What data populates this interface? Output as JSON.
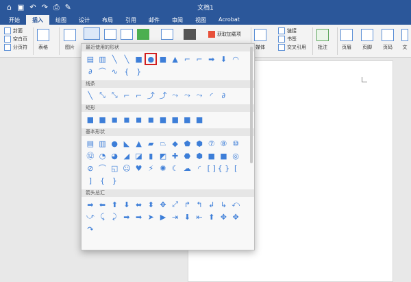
{
  "app": {
    "doc_title": "文档1",
    "qat": [
      "⌂",
      "▣",
      "↶",
      "↷",
      "⎙",
      "✎"
    ]
  },
  "tabs": [
    "开始",
    "插入",
    "绘图",
    "设计",
    "布局",
    "引用",
    "邮件",
    "审阅",
    "视图",
    "Acrobat"
  ],
  "active_tab": "插入",
  "ribbon": {
    "pages": [
      "封面",
      "空白页",
      "分页符"
    ],
    "table": "表格",
    "picture": "图片",
    "addins": "获取加载项",
    "media": "媒体",
    "links": [
      "链接",
      "书签",
      "交叉引用"
    ],
    "comment": "批注",
    "header": "页眉",
    "footer": "页脚",
    "page_number": "页码",
    "text_partial": "文"
  },
  "shapes": {
    "categories": [
      {
        "name": "最近使用的形状",
        "icons": [
          "▤",
          "▥",
          "╲",
          "╲",
          "■",
          "●",
          "■",
          "▲",
          "⌐",
          "⌐",
          "➡",
          "⬇",
          "◠",
          "∂",
          "⌒",
          "∿",
          "{",
          "}"
        ]
      },
      {
        "name": "线条",
        "icons": [
          "╲",
          "⤡",
          "⤡",
          "⌐",
          "⌐",
          "⤴",
          "⤴",
          "⤳",
          "⤳",
          "⤳",
          "◜",
          "∂"
        ]
      },
      {
        "name": "矩形",
        "icons": [
          "■",
          "■",
          "◼",
          "◼",
          "◼",
          "◼",
          "■",
          "■",
          "■",
          "■"
        ]
      },
      {
        "name": "基本形状",
        "icons": [
          "▤",
          "▥",
          "●",
          "◣",
          "▲",
          "▰",
          "⏢",
          "◆",
          "⬟",
          "⬢",
          "⑦",
          "⑧",
          "⑩",
          "⑫",
          "◔",
          "◕",
          "◢",
          "◪",
          "▮",
          "◩",
          "✚",
          "⬣",
          "⬢",
          "■",
          "■",
          "◎",
          "⊘",
          "⌒",
          "◱",
          "☺",
          "♥",
          "⚡",
          "✺",
          "☾",
          "☁",
          "◜",
          "[ ]",
          "{ }",
          "[",
          "]",
          "{",
          "}"
        ],
        "selected_index": null
      },
      {
        "name": "箭头总汇",
        "icons": [
          "➡",
          "⬅",
          "⬆",
          "⬇",
          "⬌",
          "⬍",
          "✥",
          "⤢",
          "↱",
          "↰",
          "↲",
          "↳",
          "⤺",
          "⤻",
          "⤹",
          "⤸",
          "➡",
          "➡",
          "➤",
          "▶",
          "⇥",
          "⬇",
          "⇤",
          "⬆",
          "✥",
          "✥",
          "↷"
        ]
      }
    ],
    "selected": {
      "category": 0,
      "index": 5
    }
  },
  "colors": {
    "accent": "#2b579a",
    "shape": "#3d7ed8",
    "selection": "#d21f1f"
  }
}
